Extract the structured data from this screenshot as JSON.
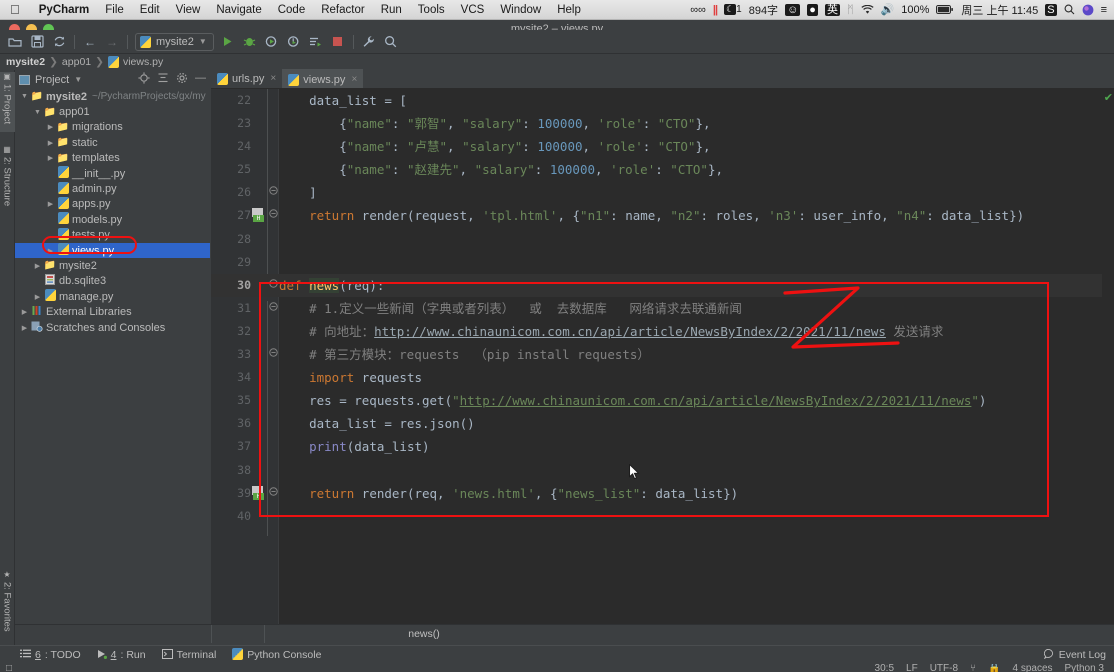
{
  "macbar": {
    "apple_icon": "apple-icon",
    "menus": [
      "PyCharm",
      "File",
      "Edit",
      "View",
      "Navigate",
      "Code",
      "Refactor",
      "Run",
      "Tools",
      "VCS",
      "Window",
      "Help"
    ],
    "status_items": [
      {
        "name": "glasses-icon",
        "text": "☘"
      },
      {
        "name": "pause-bars-icon",
        "text": "||"
      },
      {
        "name": "moon-badge",
        "text": "1"
      },
      {
        "name": "word-count",
        "text": "894字"
      },
      {
        "name": "face-icon",
        "text": "☺"
      },
      {
        "name": "mic-icon",
        "text": "ƪ"
      },
      {
        "name": "input-source-icon",
        "text": "英"
      },
      {
        "name": "bluetooth-icon",
        "text": "ᛗ"
      },
      {
        "name": "wifi-icon",
        "text": "wifi"
      },
      {
        "name": "volume-icon",
        "text": "◂))"
      },
      {
        "name": "battery-percent",
        "text": "100%"
      },
      {
        "name": "battery-icon",
        "text": "battery"
      },
      {
        "name": "clock",
        "text": "周三 上午 11:45"
      },
      {
        "name": "sogou-icon",
        "text": "S"
      },
      {
        "name": "spotlight-icon",
        "text": "search"
      },
      {
        "name": "siri-icon",
        "text": "siri"
      },
      {
        "name": "control-center-icon",
        "text": "menu"
      }
    ]
  },
  "window": {
    "title": "mysite2 – views.py"
  },
  "toolbar": {
    "open_label": "open-folder",
    "save_label": "save-all",
    "sync_label": "sync",
    "back_label": "back",
    "forward_label": "forward",
    "run_config": "mysite2",
    "run_label": "run",
    "debug_label": "debug",
    "coverage_label": "run-with-coverage",
    "profile_label": "profile",
    "attach_label": "attach",
    "stop_label": "stop",
    "settings_label": "settings",
    "search_label": "search-everywhere"
  },
  "breadcrumb": {
    "items": [
      "mysite2",
      "app01",
      "views.py"
    ],
    "separator": "❯"
  },
  "tool_strips": {
    "left_top": [
      {
        "label": "1: Project",
        "selected": true
      },
      {
        "label": "2: Structure",
        "selected": false
      }
    ],
    "left_bottom": [
      {
        "label": "2: Favorites",
        "selected": false
      }
    ]
  },
  "project_panel": {
    "title": "Project",
    "chevron": "▾",
    "actions": [
      "locate-icon",
      "collapse-all-icon",
      "settings-icon",
      "hide-icon"
    ],
    "tree": [
      {
        "depth": 0,
        "arrow": "▼",
        "icon": "folder",
        "label": "mysite2",
        "bold": true,
        "path": "~/PycharmProjects/gx/my",
        "selected": false
      },
      {
        "depth": 1,
        "arrow": "▼",
        "icon": "folder-module",
        "label": "app01",
        "bold": false,
        "path": "",
        "selected": false
      },
      {
        "depth": 2,
        "arrow": "▶",
        "icon": "folder-module",
        "label": "migrations",
        "bold": false,
        "path": "",
        "selected": false
      },
      {
        "depth": 2,
        "arrow": "▶",
        "icon": "folder",
        "label": "static",
        "bold": false,
        "path": "",
        "selected": false
      },
      {
        "depth": 2,
        "arrow": "▶",
        "icon": "folder",
        "label": "templates",
        "bold": false,
        "path": "",
        "selected": false
      },
      {
        "depth": 2,
        "arrow": "",
        "icon": "python-file",
        "label": "__init__.py",
        "bold": false,
        "path": "",
        "selected": false
      },
      {
        "depth": 2,
        "arrow": "",
        "icon": "python-file",
        "label": "admin.py",
        "bold": false,
        "path": "",
        "selected": false
      },
      {
        "depth": 2,
        "arrow": "▶",
        "icon": "python-file",
        "label": "apps.py",
        "bold": false,
        "path": "",
        "selected": false
      },
      {
        "depth": 2,
        "arrow": "",
        "icon": "python-file",
        "label": "models.py",
        "bold": false,
        "path": "",
        "selected": false
      },
      {
        "depth": 2,
        "arrow": "",
        "icon": "python-file",
        "label": "tests.py",
        "bold": false,
        "path": "",
        "selected": false
      },
      {
        "depth": 2,
        "arrow": "▶",
        "icon": "python-file",
        "label": "views.py",
        "bold": false,
        "path": "",
        "selected": true
      },
      {
        "depth": 1,
        "arrow": "▶",
        "icon": "folder-module",
        "label": "mysite2",
        "bold": false,
        "path": "",
        "selected": false
      },
      {
        "depth": 1,
        "arrow": "",
        "icon": "db-file",
        "label": "db.sqlite3",
        "bold": false,
        "path": "",
        "selected": false
      },
      {
        "depth": 1,
        "arrow": "▶",
        "icon": "python-file",
        "label": "manage.py",
        "bold": false,
        "path": "",
        "selected": false
      },
      {
        "depth": 0,
        "arrow": "▶",
        "icon": "library",
        "label": "External Libraries",
        "bold": false,
        "path": "",
        "selected": false
      },
      {
        "depth": 0,
        "arrow": "▶",
        "icon": "scratch",
        "label": "Scratches and Consoles",
        "bold": false,
        "path": "",
        "selected": false
      }
    ]
  },
  "editor_tabs": [
    {
      "label": "urls.py",
      "active": false,
      "close": "×"
    },
    {
      "label": "views.py",
      "active": true,
      "close": "×"
    }
  ],
  "editor": {
    "current_line": 30,
    "lines": [
      {
        "n": 22,
        "gutter": "",
        "fold": "",
        "tokens": [
          {
            "t": "    data_list = [",
            "c": "pun"
          }
        ]
      },
      {
        "n": 23,
        "gutter": "",
        "fold": "",
        "tokens": [
          {
            "t": "        {",
            "c": "pun"
          },
          {
            "t": "\"name\"",
            "c": "str"
          },
          {
            "t": ": ",
            "c": "pun"
          },
          {
            "t": "\"郭智\"",
            "c": "str"
          },
          {
            "t": ", ",
            "c": "pun"
          },
          {
            "t": "\"salary\"",
            "c": "str"
          },
          {
            "t": ": ",
            "c": "pun"
          },
          {
            "t": "100000",
            "c": "num"
          },
          {
            "t": ", ",
            "c": "pun"
          },
          {
            "t": "'role'",
            "c": "str"
          },
          {
            "t": ": ",
            "c": "pun"
          },
          {
            "t": "\"CTO\"",
            "c": "str"
          },
          {
            "t": "},",
            "c": "pun"
          }
        ]
      },
      {
        "n": 24,
        "gutter": "",
        "fold": "",
        "tokens": [
          {
            "t": "        {",
            "c": "pun"
          },
          {
            "t": "\"name\"",
            "c": "str"
          },
          {
            "t": ": ",
            "c": "pun"
          },
          {
            "t": "\"卢慧\"",
            "c": "str"
          },
          {
            "t": ", ",
            "c": "pun"
          },
          {
            "t": "\"salary\"",
            "c": "str"
          },
          {
            "t": ": ",
            "c": "pun"
          },
          {
            "t": "100000",
            "c": "num"
          },
          {
            "t": ", ",
            "c": "pun"
          },
          {
            "t": "'role'",
            "c": "str"
          },
          {
            "t": ": ",
            "c": "pun"
          },
          {
            "t": "\"CTO\"",
            "c": "str"
          },
          {
            "t": "},",
            "c": "pun"
          }
        ]
      },
      {
        "n": 25,
        "gutter": "",
        "fold": "",
        "tokens": [
          {
            "t": "        {",
            "c": "pun"
          },
          {
            "t": "\"name\"",
            "c": "str"
          },
          {
            "t": ": ",
            "c": "pun"
          },
          {
            "t": "\"赵建先\"",
            "c": "str"
          },
          {
            "t": ", ",
            "c": "pun"
          },
          {
            "t": "\"salary\"",
            "c": "str"
          },
          {
            "t": ": ",
            "c": "pun"
          },
          {
            "t": "100000",
            "c": "num"
          },
          {
            "t": ", ",
            "c": "pun"
          },
          {
            "t": "'role'",
            "c": "str"
          },
          {
            "t": ": ",
            "c": "pun"
          },
          {
            "t": "\"CTO\"",
            "c": "str"
          },
          {
            "t": "},",
            "c": "pun"
          }
        ]
      },
      {
        "n": 26,
        "gutter": "",
        "fold": "collapse",
        "tokens": [
          {
            "t": "    ]",
            "c": "pun"
          }
        ]
      },
      {
        "n": 27,
        "gutter": "run",
        "fold": "collapse",
        "tokens": [
          {
            "t": "    ",
            "c": "pun"
          },
          {
            "t": "return",
            "c": "kw"
          },
          {
            "t": " render(request, ",
            "c": "pun"
          },
          {
            "t": "'tpl.html'",
            "c": "str"
          },
          {
            "t": ", {",
            "c": "pun"
          },
          {
            "t": "\"n1\"",
            "c": "str"
          },
          {
            "t": ": name, ",
            "c": "pun"
          },
          {
            "t": "\"n2\"",
            "c": "str"
          },
          {
            "t": ": roles, ",
            "c": "pun"
          },
          {
            "t": "'n3'",
            "c": "str"
          },
          {
            "t": ": user_info, ",
            "c": "pun"
          },
          {
            "t": "\"n4\"",
            "c": "str"
          },
          {
            "t": ": data_list})",
            "c": "pun"
          }
        ]
      },
      {
        "n": 28,
        "gutter": "",
        "fold": "",
        "tokens": []
      },
      {
        "n": 29,
        "gutter": "",
        "fold": "",
        "tokens": []
      },
      {
        "n": 30,
        "gutter": "",
        "fold": "collapse",
        "current": true,
        "tokens": [
          {
            "t": "def ",
            "c": "kw"
          },
          {
            "t": "news",
            "c": "fn hl-def"
          },
          {
            "t": "(req):",
            "c": "pun"
          }
        ]
      },
      {
        "n": 31,
        "gutter": "",
        "fold": "collapse",
        "tokens": [
          {
            "t": "    # 1.定义一些新闻（字典或者列表）  或  去数据库   网络请求去联通新闻",
            "c": "cmt"
          }
        ]
      },
      {
        "n": 32,
        "gutter": "",
        "fold": "",
        "tokens": [
          {
            "t": "    # 向地址：",
            "c": "cmt"
          },
          {
            "t": "http://www.chinaunicom.com.cn/api/article/NewsByIndex/2/2021/11/news",
            "c": "lnkc"
          },
          {
            "t": " 发送请求",
            "c": "cmt"
          }
        ]
      },
      {
        "n": 33,
        "gutter": "",
        "fold": "collapse",
        "tokens": [
          {
            "t": "    # 第三方模块：requests  （pip install requests）",
            "c": "cmt"
          }
        ]
      },
      {
        "n": 34,
        "gutter": "",
        "fold": "",
        "tokens": [
          {
            "t": "    ",
            "c": "pun"
          },
          {
            "t": "import",
            "c": "kw"
          },
          {
            "t": " requests",
            "c": "pun"
          }
        ]
      },
      {
        "n": 35,
        "gutter": "",
        "fold": "",
        "tokens": [
          {
            "t": "    res = requests.get(",
            "c": "pun"
          },
          {
            "t": "\"",
            "c": "str"
          },
          {
            "t": "http://www.chinaunicom.com.cn/api/article/NewsByIndex/2/2021/11/news",
            "c": "lnk"
          },
          {
            "t": "\"",
            "c": "str"
          },
          {
            "t": ")",
            "c": "pun"
          }
        ]
      },
      {
        "n": 36,
        "gutter": "",
        "fold": "",
        "tokens": [
          {
            "t": "    data_list = res.json()",
            "c": "pun"
          }
        ]
      },
      {
        "n": 37,
        "gutter": "",
        "fold": "",
        "tokens": [
          {
            "t": "    ",
            "c": "pun"
          },
          {
            "t": "print",
            "c": "bi"
          },
          {
            "t": "(data_list)",
            "c": "pun"
          }
        ]
      },
      {
        "n": 38,
        "gutter": "",
        "fold": "",
        "tokens": []
      },
      {
        "n": 39,
        "gutter": "run",
        "fold": "collapse",
        "tokens": [
          {
            "t": "    ",
            "c": "pun"
          },
          {
            "t": "return",
            "c": "kw"
          },
          {
            "t": " render(req, ",
            "c": "pun"
          },
          {
            "t": "'news.html'",
            "c": "str"
          },
          {
            "t": ", {",
            "c": "pun"
          },
          {
            "t": "\"news_list\"",
            "c": "str"
          },
          {
            "t": ": data_list})",
            "c": "pun"
          }
        ]
      },
      {
        "n": 40,
        "gutter": "",
        "fold": "",
        "tokens": []
      }
    ],
    "inspection_ok": "✔",
    "annotation_color": "#ee1111"
  },
  "bottom_breadcrumb": {
    "label": "news()"
  },
  "statusbar": {
    "items": [
      {
        "name": "todo-button",
        "num": "6",
        "label": ": TODO",
        "icon": "list-icon"
      },
      {
        "name": "run-button",
        "num": "4",
        "label": ": Run",
        "icon": "play-icon"
      },
      {
        "name": "terminal-button",
        "num": "",
        "label": "Terminal",
        "icon": "terminal-icon"
      },
      {
        "name": "python-console-button",
        "num": "",
        "label": "Python Console",
        "icon": "python-icon"
      }
    ],
    "event_log": "Event Log"
  },
  "footer": {
    "caret": "30:5",
    "line_sep": "LF",
    "encoding": "UTF-8",
    "indent": "4 spaces",
    "interpreter": "Python 3",
    "branch": "git-branch-icon",
    "lock": "lock-icon"
  }
}
